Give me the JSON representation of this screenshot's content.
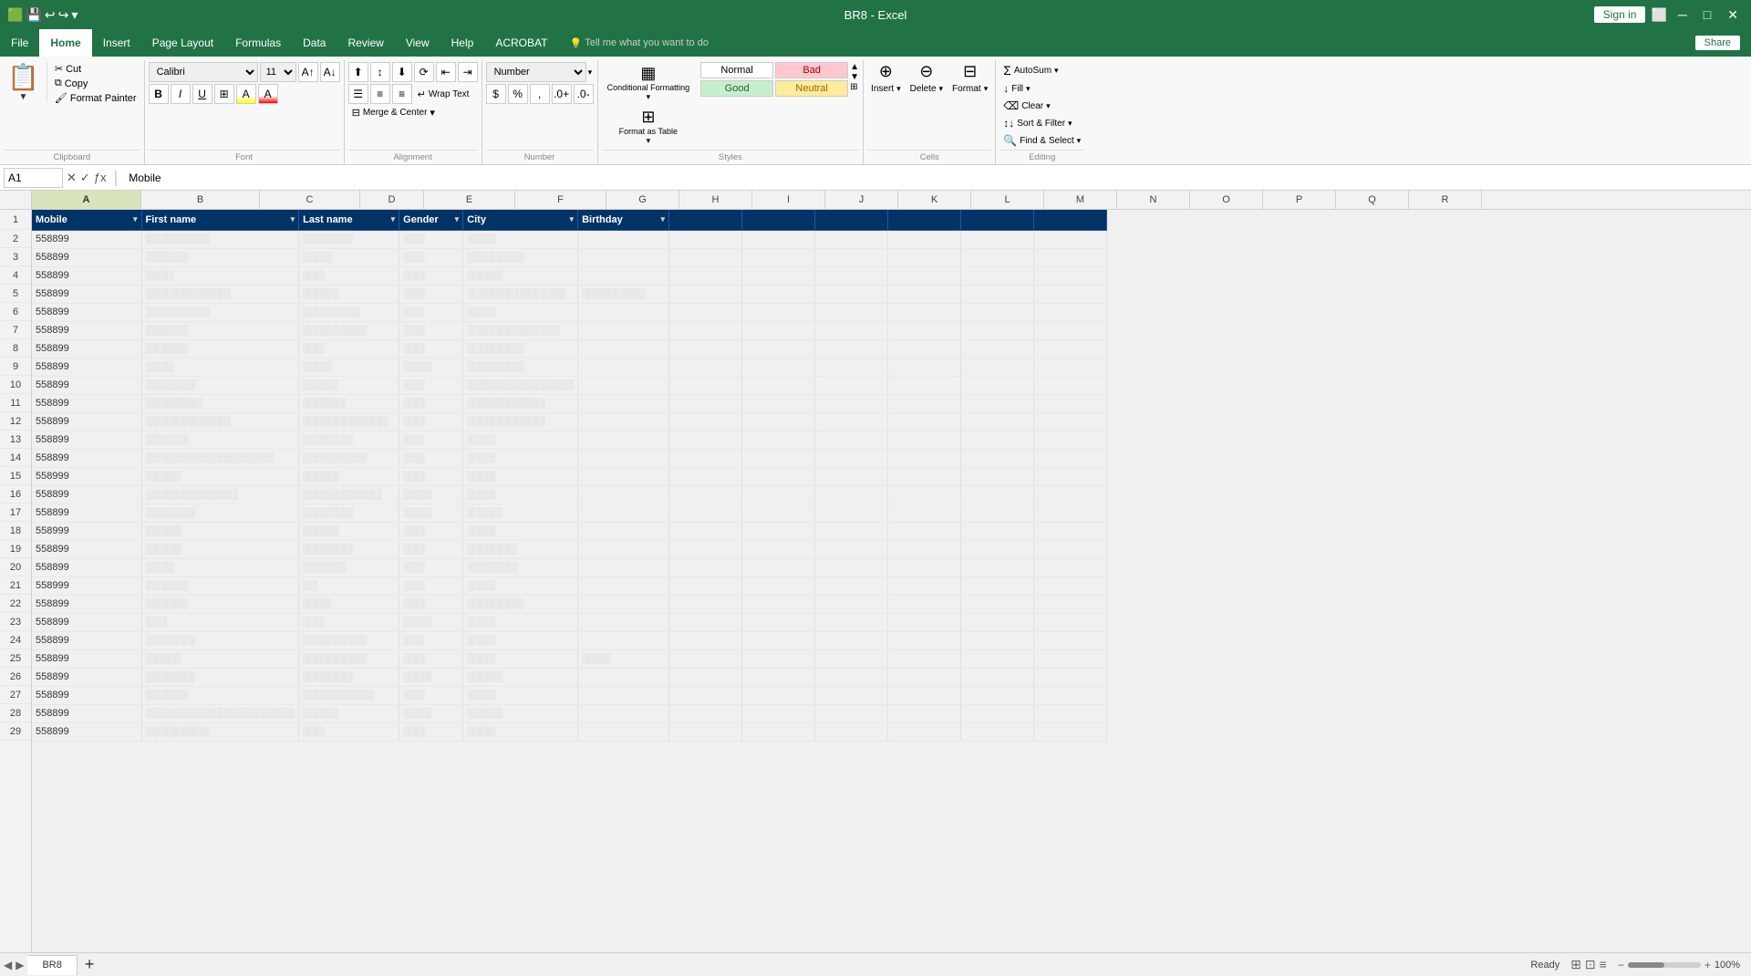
{
  "titleBar": {
    "fileName": "BR8",
    "appName": "Excel",
    "title": "BR8 - Excel",
    "signIn": "Sign in",
    "share": "Share"
  },
  "menuBar": {
    "items": [
      "File",
      "Home",
      "Insert",
      "Page Layout",
      "Formulas",
      "Data",
      "Review",
      "View",
      "Help",
      "ACROBAT"
    ],
    "activeItem": "Home",
    "tellMe": "Tell me what you want to do"
  },
  "ribbon": {
    "clipboard": {
      "label": "Clipboard",
      "paste": "Paste",
      "cut": "Cut",
      "copy": "Copy",
      "formatPainter": "Format Painter"
    },
    "font": {
      "label": "Font",
      "fontFamily": "Calibri",
      "fontSize": "11",
      "bold": "B",
      "italic": "I",
      "underline": "U"
    },
    "alignment": {
      "label": "Alignment",
      "wrapText": "Wrap Text",
      "mergeCenter": "Merge & Center"
    },
    "number": {
      "label": "Number",
      "format": "Number"
    },
    "styles": {
      "label": "Styles",
      "normal": "Normal",
      "bad": "Bad",
      "good": "Good",
      "neutral": "Neutral",
      "conditionalFormatting": "Conditional Formatting",
      "formatAsTable": "Format as Table"
    },
    "cells": {
      "label": "Cells",
      "insert": "Insert",
      "delete": "Delete",
      "format": "Format"
    },
    "editing": {
      "label": "Editing",
      "autoSum": "AutoSum",
      "fill": "Fill",
      "clear": "Clear",
      "sortFilter": "Sort & Filter",
      "findSelect": "Find & Select"
    }
  },
  "formulaBar": {
    "cellRef": "A1",
    "formula": "Mobile"
  },
  "columns": {
    "rowHeader": "",
    "headers": [
      "A",
      "B",
      "C",
      "D",
      "E",
      "F",
      "G",
      "H",
      "I",
      "J",
      "K",
      "L",
      "M",
      "N",
      "O",
      "P",
      "Q",
      "R"
    ]
  },
  "tableHeaders": {
    "mobile": "Mobile",
    "firstName": "First name",
    "lastName": "Last name",
    "gender": "Gender",
    "city": "City",
    "birthday": "Birthday"
  },
  "tableData": [
    {
      "mobile": "558899",
      "firstName": "░░░░░░░░░",
      "lastName": "░░░░░░░",
      "gender": "░░░",
      "city": "░░░░",
      "birthday": ""
    },
    {
      "mobile": "558899",
      "firstName": "░░░░░░",
      "lastName": "░░░░",
      "gender": "░░░",
      "city": "░░░░░░░░",
      "birthday": ""
    },
    {
      "mobile": "558899",
      "firstName": "░░░░",
      "lastName": "░░░",
      "gender": "░░░",
      "city": "░░░░░",
      "birthday": ""
    },
    {
      "mobile": "558899",
      "firstName": "░░░░░░░░░░░░",
      "lastName": "░░░░░",
      "gender": "░░░",
      "city": "░░░░░░░░░░░░░░",
      "birthday": "░░░░░░░░░"
    },
    {
      "mobile": "558899",
      "firstName": "░░░░░░░░░",
      "lastName": "░░░░░░░░",
      "gender": "░░░",
      "city": "░░░░",
      "birthday": ""
    },
    {
      "mobile": "558899",
      "firstName": "░░░░░░",
      "lastName": "░░░░░░░░░",
      "gender": "░░░",
      "city": "░░░░░░░░░░░░░",
      "birthday": ""
    },
    {
      "mobile": "558899",
      "firstName": "░░░░░░",
      "lastName": "░░░",
      "gender": "░░░",
      "city": "░░░░░░░░",
      "birthday": ""
    },
    {
      "mobile": "558899",
      "firstName": "░░░░",
      "lastName": "░░░░",
      "gender": "░░░░",
      "city": "░░░░░░░░",
      "birthday": ""
    },
    {
      "mobile": "558899",
      "firstName": "░░░░░░░",
      "lastName": "░░░░░",
      "gender": "░░░",
      "city": "░░░░░░░░░░░░░░░",
      "birthday": ""
    },
    {
      "mobile": "558899",
      "firstName": "░░░░░░░░",
      "lastName": "░░░░░░",
      "gender": "░░░",
      "city": "░░░░░░░░░░░",
      "birthday": ""
    },
    {
      "mobile": "558899",
      "firstName": "░░░░░░░░░░░░",
      "lastName": "░░░░░░░░░░░░",
      "gender": "░░░",
      "city": "░░░░░░░░░░░",
      "birthday": ""
    },
    {
      "mobile": "558899",
      "firstName": "░░░░░░",
      "lastName": "░░░░░░░",
      "gender": "░░░",
      "city": "░░░░",
      "birthday": ""
    },
    {
      "mobile": "558899",
      "firstName": "░░░░░░░░░░░░░░░░░░",
      "lastName": "░░░░░░░░░",
      "gender": "░░░",
      "city": "░░░░",
      "birthday": ""
    },
    {
      "mobile": "558999",
      "firstName": "░░░░░",
      "lastName": "░░░░░",
      "gender": "░░░",
      "city": "░░░░",
      "birthday": ""
    },
    {
      "mobile": "558899",
      "firstName": "░░░░░░░░░░░░░",
      "lastName": "░░░░░░░░░░░",
      "gender": "░░░░",
      "city": "░░░░",
      "birthday": ""
    },
    {
      "mobile": "558899",
      "firstName": "░░░░░░░",
      "lastName": "░░░░░░░",
      "gender": "░░░░",
      "city": "░░░░░",
      "birthday": ""
    },
    {
      "mobile": "558999",
      "firstName": "░░░░░",
      "lastName": "░░░░░",
      "gender": "░░░",
      "city": "░░░░",
      "birthday": ""
    },
    {
      "mobile": "558899",
      "firstName": "░░░░░",
      "lastName": "░░░░░░░",
      "gender": "░░░",
      "city": "░░░░░░░",
      "birthday": ""
    },
    {
      "mobile": "558899",
      "firstName": "░░░░",
      "lastName": "░░░░░░",
      "gender": "░░░",
      "city": "░░░░░░░",
      "birthday": ""
    },
    {
      "mobile": "558999",
      "firstName": "░░░░░░",
      "lastName": "░░",
      "gender": "░░░",
      "city": "░░░░",
      "birthday": ""
    },
    {
      "mobile": "558899",
      "firstName": "░░░░░░",
      "lastName": "░░░░",
      "gender": "░░░",
      "city": "░░░░░░░░",
      "birthday": ""
    },
    {
      "mobile": "558899",
      "firstName": "░░░",
      "lastName": "░░░",
      "gender": "░░░░",
      "city": "░░░░",
      "birthday": ""
    },
    {
      "mobile": "558899",
      "firstName": "░░░░░░░",
      "lastName": "░░░░░░░░░",
      "gender": "░░░",
      "city": "░░░░",
      "birthday": ""
    },
    {
      "mobile": "558899",
      "firstName": "░░░░░",
      "lastName": "░░░░░░░░░",
      "gender": "░░░",
      "city": "░░░░",
      "birthday": "░░░░"
    },
    {
      "mobile": "558899",
      "firstName": "░░░░░░░",
      "lastName": "░░░░░░░",
      "gender": "░░░░",
      "city": "░░░░░",
      "birthday": ""
    },
    {
      "mobile": "558899",
      "firstName": "░░░░░░",
      "lastName": "░░░░░░░░░░",
      "gender": "░░░",
      "city": "░░░░",
      "birthday": ""
    },
    {
      "mobile": "558899",
      "firstName": "░░░░░░░░░░░░░░░░░░░░░",
      "lastName": "░░░░░",
      "gender": "░░░░",
      "city": "░░░░░",
      "birthday": ""
    },
    {
      "mobile": "558899",
      "firstName": "░░░░░░░░░",
      "lastName": "░░░",
      "gender": "░░░",
      "city": "░░░░",
      "birthday": ""
    }
  ],
  "bottomBar": {
    "status": "Ready",
    "sheetName": "BR8",
    "addSheet": "+",
    "scrollLeft": "◀",
    "scrollRight": "▶"
  },
  "colors": {
    "excelGreen": "#217346",
    "headerBlue": "#003366",
    "badBg": "#ffc7ce",
    "badColor": "#9c0006",
    "goodBg": "#c6efce",
    "goodColor": "#276221",
    "neutralBg": "#ffeb9c",
    "neutralColor": "#9c6500"
  }
}
